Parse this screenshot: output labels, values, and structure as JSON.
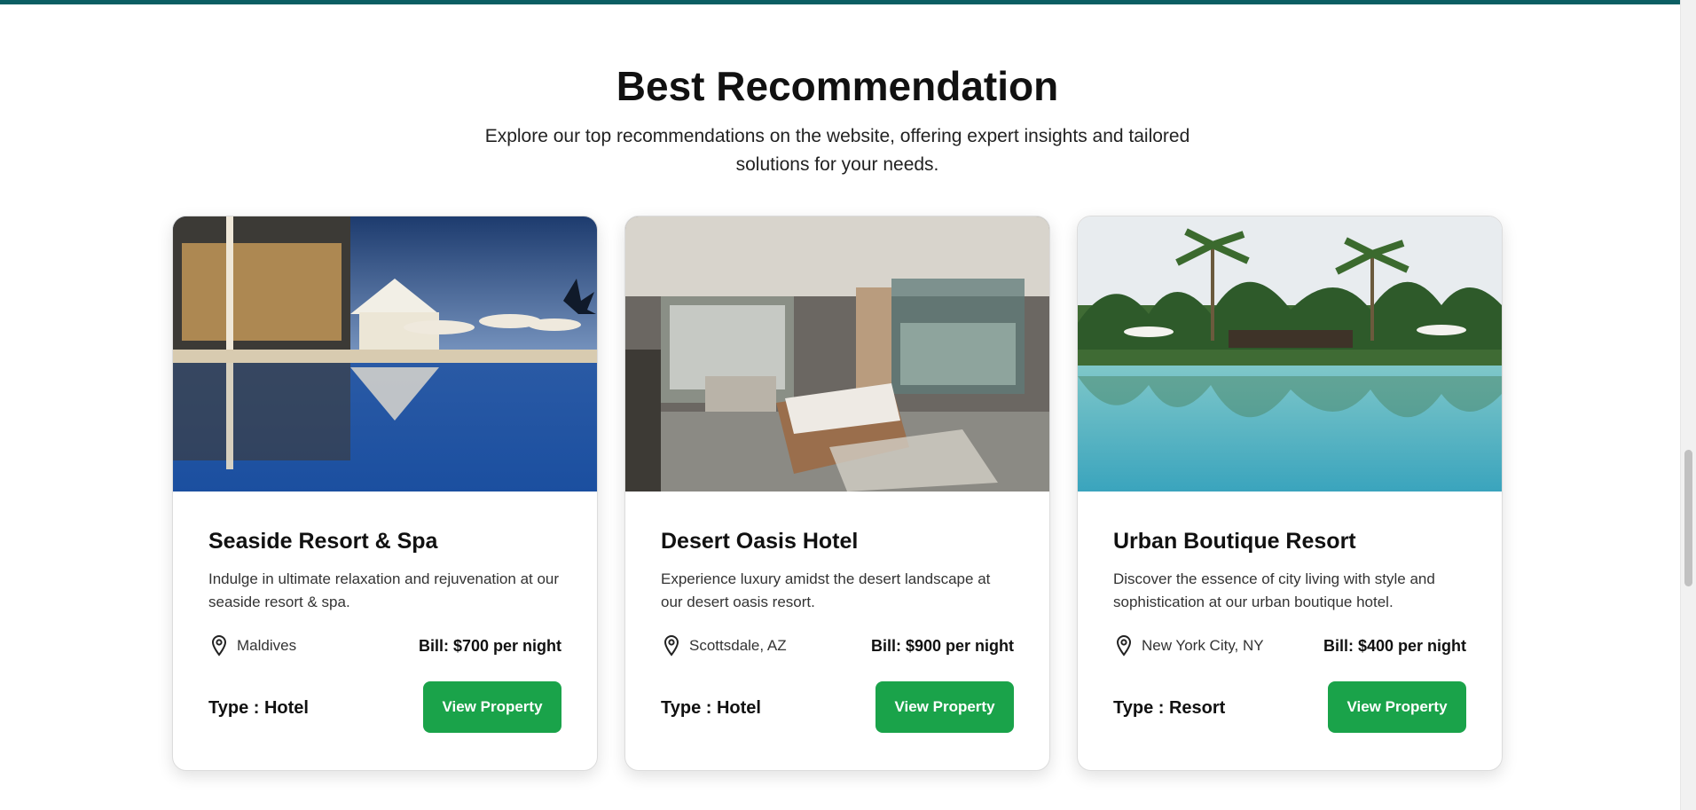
{
  "section": {
    "title": "Best Recommendation",
    "subtitle": "Explore our top recommendations on the website, offering expert insights and tailored solutions for your needs."
  },
  "cards": [
    {
      "name": "Seaside Resort & Spa",
      "description": "Indulge in ultimate relaxation and rejuvenation at our seaside resort & spa.",
      "location": "Maldives",
      "bill": "Bill: $700 per night",
      "type": "Type : Hotel",
      "button": "View Property",
      "image": "resort-pool-night-photo"
    },
    {
      "name": "Desert Oasis Hotel",
      "description": "Experience luxury amidst the desert landscape at our desert oasis resort.",
      "location": "Scottsdale, AZ",
      "bill": "Bill: $900 per night",
      "type": "Type : Hotel",
      "button": "View Property",
      "image": "desert-bedroom-interior-photo"
    },
    {
      "name": "Urban Boutique Resort",
      "description": "Discover the essence of city living with style and sophistication at our urban boutique hotel.",
      "location": "New York City, NY",
      "bill": "Bill: $400 per night",
      "type": "Type : Resort",
      "button": "View Property",
      "image": "palm-pool-photo"
    }
  ],
  "colors": {
    "accent": "#1aa34a",
    "topbar": "#0b5e63"
  }
}
